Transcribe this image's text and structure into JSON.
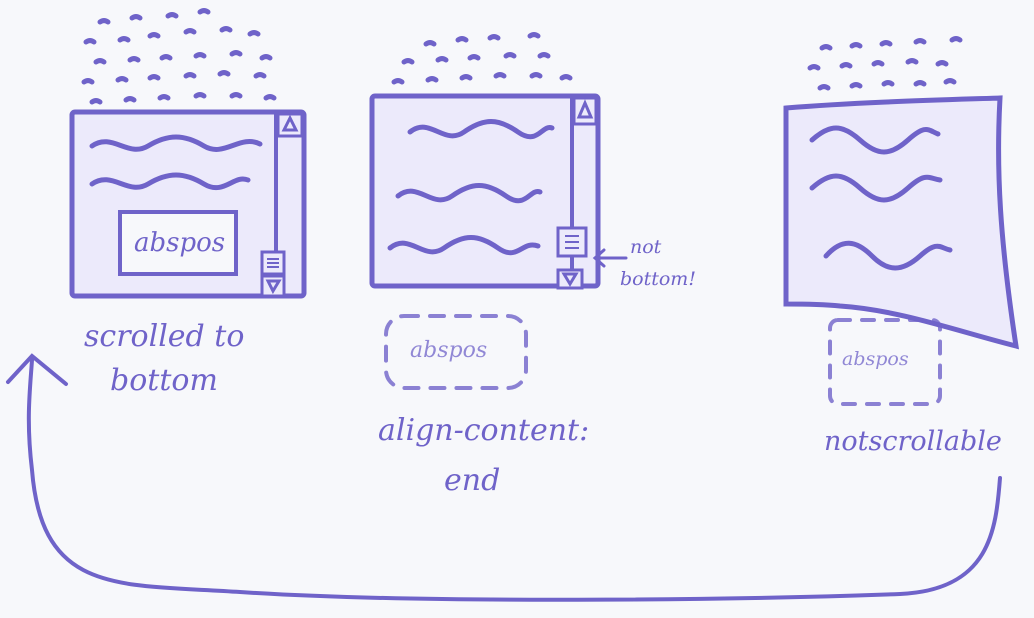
{
  "colors": {
    "ink": "#6f63c9",
    "ink_light": "#a39ce0",
    "ink_fill": "#eceafb",
    "board": "#f7f8fb"
  },
  "panels": [
    {
      "id": "scrolled-to-bottom",
      "inner_box_label": "abspos",
      "caption_line1": "scrolled to",
      "caption_line2": "bottom",
      "scrollbar_icons": [
        "up-arrow-icon",
        "scroll-thumb-icon",
        "down-arrow-icon"
      ]
    },
    {
      "id": "align-content-end",
      "dashed_box_label": "abspos",
      "side_note_line1": "not",
      "side_note_line2": "bottom!",
      "caption_line1": "align-content:",
      "caption_line2": "end",
      "scrollbar_icons": [
        "up-arrow-icon",
        "scroll-thumb-icon",
        "down-arrow-icon"
      ]
    },
    {
      "id": "not-scrollable",
      "dashed_box_label": "abspos",
      "caption": "notscrollable"
    }
  ]
}
